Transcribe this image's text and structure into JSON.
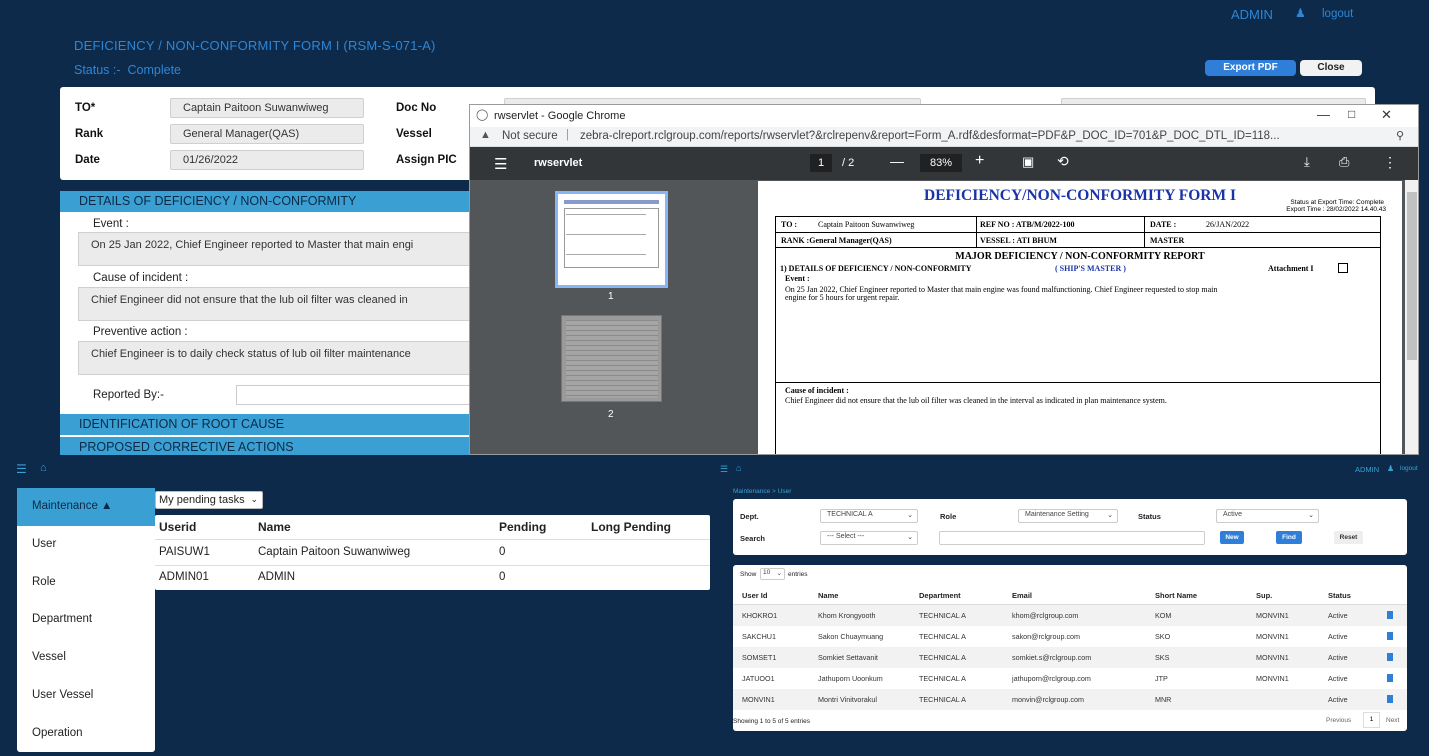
{
  "form": {
    "user": "ADMIN",
    "logout": "logout",
    "title": "DEFICIENCY / NON-CONFORMITY FORM I (RSM-S-071-A)",
    "status_label": "Status :-",
    "status_value": "Complete",
    "export_pdf": "Export PDF",
    "close": "Close",
    "fields": {
      "to_label": "TO*",
      "to_value": "Captain Paitoon Suwanwiweg",
      "rank_label": "Rank",
      "rank_value": "General Manager(QAS)",
      "date_label": "Date",
      "date_value": "01/26/2022",
      "docno_label": "Doc No",
      "vessel_label": "Vessel",
      "assign_label": "Assign PIC"
    },
    "section_details": "DETAILS OF DEFICIENCY / NON-CONFORMITY",
    "event_label": "Event :",
    "event_text": "On 25 Jan 2022, Chief Engineer reported to Master that main engi",
    "cause_label": "Cause of incident :",
    "cause_text": "Chief Engineer did not ensure that the lub oil filter was cleaned in",
    "preventive_label": "Preventive action :",
    "preventive_text": "Chief Engineer is to daily check status of lub oil filter maintenance",
    "reported_label": "Reported By:-",
    "section_root": "IDENTIFICATION OF ROOT CAUSE",
    "section_corrective": "PROPOSED CORRECTIVE ACTIONS"
  },
  "chrome": {
    "window_title": "rwservlet - Google Chrome",
    "not_secure": "Not secure",
    "url": "zebra-clreport.rclgroup.com/reports/rwservlet?&rclrepenv&report=Form_A.rdf&desformat=PDF&P_DOC_ID=701&P_DOC_DTL_ID=118...",
    "pdf_name": "rwservlet",
    "page_current": "1",
    "page_total": "/ 2",
    "zoom": "83%",
    "thumb1": "1",
    "thumb2": "2"
  },
  "pdf": {
    "heading": "DEFICIENCY/NON-CONFORMITY FORM I",
    "export_status": "Status at Export Time: Complete",
    "export_time": "Export Time : 28/02/2022 14.40.43",
    "to": "TO :",
    "to_value": "Captain Paitoon Suwanwiweg",
    "ref": "REF NO : ATB/M/2022-100",
    "date": "DATE :",
    "date_value": "26/JAN/2022",
    "rank": "RANK :General Manager(QAS)",
    "vessel": "VESSEL : ATI BHUM",
    "master": "MASTER",
    "major": "MAJOR DEFICIENCY / NON-CONFORMITY REPORT",
    "details": "1) DETAILS OF DEFICIENCY / NON-CONFORMITY",
    "ships_master": "( SHIP'S MASTER )",
    "attachment": "Attachment I",
    "event": "Event :",
    "event_text": "On 25 Jan 2022, Chief Engineer reported to Master that main engine was found malfunctioning. Chief Engineer requested to stop main",
    "event_text2": "engine for 5 hours for urgent repair.",
    "cause": "Cause of incident :",
    "cause_text": "Chief Engineer did not ensure that the lub oil filter was cleaned in the interval as indicated in plan maintenance system."
  },
  "pending": {
    "menu": [
      "Maintenance ▲",
      "User",
      "Role",
      "Department",
      "Vessel",
      "User Vessel",
      "Operation"
    ],
    "filter": "My pending tasks",
    "headers": [
      "Userid",
      "Name",
      "Pending",
      "Long Pending"
    ],
    "rows": [
      [
        "PAISUW1",
        "Captain Paitoon Suwanwiweg",
        "0",
        ""
      ],
      [
        "ADMIN01",
        "ADMIN",
        "0",
        ""
      ]
    ]
  },
  "users": {
    "admin": "ADMIN",
    "logout": "logout",
    "breadcrumb_root": "Maintenance",
    "breadcrumb_sep": ">",
    "breadcrumb_page": "User",
    "dept_label": "Dept.",
    "dept_value": "TECHNICAL A",
    "role_label": "Role",
    "role_value": "Maintenance Setting",
    "status_label": "Status",
    "status_value": "Active",
    "search_label": "Search",
    "search_value": "--- Select ---",
    "btn_new": "New",
    "btn_find": "Find",
    "btn_reset": "Reset",
    "show": "Show",
    "show_count": "10",
    "entries": "entries",
    "headers": [
      "User Id",
      "Name",
      "Department",
      "Email",
      "Short Name",
      "Sup.",
      "Status"
    ],
    "rows": [
      [
        "KHOKRO1",
        "Khom Krongyooth",
        "TECHNICAL A",
        "khom@rclgroup.com",
        "KOM",
        "MONVIN1",
        "Active"
      ],
      [
        "SAKCHU1",
        "Sakon Chuaymuang",
        "TECHNICAL A",
        "sakon@rclgroup.com",
        "SKO",
        "MONVIN1",
        "Active"
      ],
      [
        "SOMSET1",
        "Somkiet Settavanit",
        "TECHNICAL A",
        "somkiet.s@rclgroup.com",
        "SKS",
        "MONVIN1",
        "Active"
      ],
      [
        "JATUOO1",
        "Jathuporn Uoonkum",
        "TECHNICAL A",
        "jathuporn@rclgroup.com",
        "JTP",
        "MONVIN1",
        "Active"
      ],
      [
        "MONVIN1",
        "Montri Vinitvorakul",
        "TECHNICAL A",
        "monvin@rclgroup.com",
        "MNR",
        "",
        "Active"
      ]
    ],
    "showing": "Showing 1 to 5 of 5 entries",
    "prev": "Previous",
    "page": "1",
    "next": "Next"
  }
}
